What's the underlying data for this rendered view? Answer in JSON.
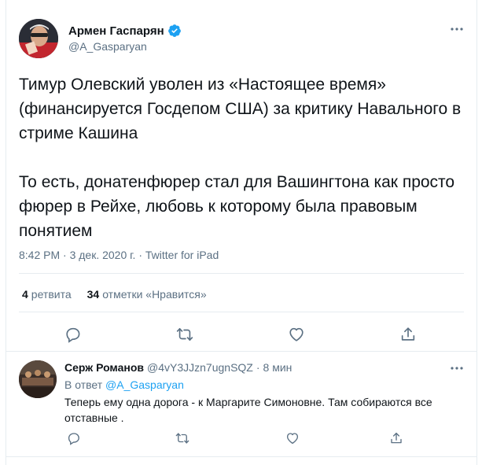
{
  "main_tweet": {
    "author_name": "Армен Гаспарян",
    "author_handle": "@A_Gasparyan",
    "text": "Тимур Олевский уволен из «Настоящее время» (финансируется Госдепом США) за критику Навального в стриме Кашина\n\nТо есть, донатенфюрер стал для Вашингтона как просто фюрер в Рейхе, любовь к которому была правовым понятием",
    "meta": "8:42 PM · 3 дек. 2020 г. · Twitter for iPad",
    "retweets_count": "4",
    "retweets_label": "ретвита",
    "likes_count": "34",
    "likes_label": "отметки «Нравится»",
    "icons": {
      "verified": "verified-badge-icon",
      "more": "more-dots-icon",
      "reply": "reply-icon",
      "retweet": "retweet-icon",
      "like": "heart-icon",
      "share": "share-icon"
    }
  },
  "reply": {
    "author_name": "Серж Романов",
    "author_handle": "@4vY3JJzn7ugnSQZ",
    "separator": "·",
    "time": "8 мин",
    "in_reply_prefix": "В ответ",
    "in_reply_handle": "@A_Gasparyan",
    "text": "Теперь ему одна дорога - к Маргарите Симоновне. Там собираются все отставные ."
  },
  "colors": {
    "accent": "#1da1f2",
    "text_primary": "#0f1419",
    "text_secondary": "#5b7083",
    "divider": "#e6ecf0"
  }
}
